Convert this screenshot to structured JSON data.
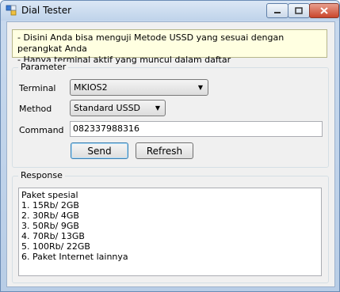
{
  "window": {
    "title": "Dial Tester"
  },
  "info": {
    "lines": [
      "- Disini Anda bisa menguji Metode USSD yang sesuai dengan perangkat Anda",
      "- Hanya terminal aktif yang muncul dalam daftar"
    ]
  },
  "parameter": {
    "group_label": "Parameter",
    "terminal_label": "Terminal",
    "terminal_value": "MKIOS2",
    "method_label": "Method",
    "method_value": "Standard USSD",
    "command_label": "Command",
    "command_value": "082337988316",
    "send_label": "Send",
    "refresh_label": "Refresh"
  },
  "response": {
    "group_label": "Response",
    "lines": [
      "Paket spesial",
      "1. 15Rb/ 2GB",
      "2. 30Rb/ 4GB",
      "3. 50Rb/ 9GB",
      "4. 70Rb/ 13GB",
      "5. 100Rb/ 22GB",
      "6. Paket Internet lainnya"
    ]
  },
  "icons": [
    "app-icon",
    "minimize-icon",
    "maximize-icon",
    "close-icon",
    "dropdown-arrow-icon"
  ]
}
